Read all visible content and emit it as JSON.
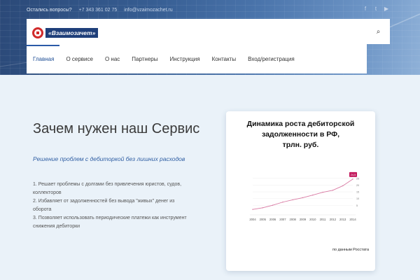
{
  "topbar": {
    "question": "Остались вопросы?",
    "phone": "+7 343 361 02 75",
    "email": "info@vzaimozachet.ru"
  },
  "social": [
    {
      "icon": "facebook-icon",
      "glyph": "f"
    },
    {
      "icon": "twitter-icon",
      "glyph": "t"
    },
    {
      "icon": "youtube-icon",
      "glyph": "▶"
    }
  ],
  "logo": {
    "text": "«Взаимозачет»"
  },
  "nav": [
    {
      "label": "Главная",
      "active": true
    },
    {
      "label": "О сервисе",
      "active": false
    },
    {
      "label": "О нас",
      "active": false
    },
    {
      "label": "Партнеры",
      "active": false
    },
    {
      "label": "Инструкция",
      "active": false
    },
    {
      "label": "Контакты",
      "active": false
    },
    {
      "label": "Вход/регистрация",
      "active": false
    }
  ],
  "search": {
    "glyph": "⌕"
  },
  "main": {
    "heading": "Зачем нужен наш Сервис",
    "subtitle": "Решение проблем с дебиторкой без лишних расходов",
    "points": [
      "1. Решает проблемы с долгами без привлечения юристов, судов, коллекторов",
      "2. Избавляет от задолженностей без вывода \"живых\" денег из оборота",
      "3. Позволяет использовать периодические платежи как инструмент снижения дебиторки"
    ]
  },
  "card": {
    "title_lines": [
      "Динамика роста дебиторской",
      "задолженности в РФ,",
      "трлн. руб."
    ],
    "source": "по данным Росстата"
  },
  "chart_data": {
    "type": "line",
    "x": [
      "2004",
      "2005",
      "2006",
      "2007",
      "2008",
      "2009",
      "2010",
      "2011",
      "2012",
      "2013",
      "2014"
    ],
    "values": [
      2.0,
      3.2,
      5.1,
      7.4,
      9.1,
      10.7,
      12.6,
      14.7,
      16.2,
      19.5,
      24.5
    ],
    "y_ticks": [
      "25",
      "20",
      "15",
      "10",
      "5"
    ],
    "ylim": [
      0,
      27
    ],
    "end_label": "24,5",
    "line_color": "#d97ba4",
    "marker_color": "#c2185b"
  }
}
